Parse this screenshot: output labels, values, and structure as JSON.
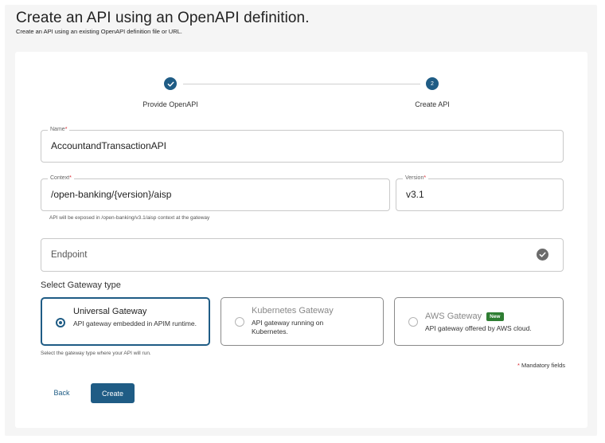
{
  "header": {
    "title": "Create an API using an OpenAPI definition.",
    "subtitle": "Create an API using an existing OpenAPI definition file or URL."
  },
  "stepper": {
    "steps": [
      {
        "label": "Provide OpenAPI",
        "state": "completed",
        "icon": "check-icon"
      },
      {
        "label": "Create API",
        "state": "active",
        "number": "2"
      }
    ]
  },
  "form": {
    "name": {
      "label": "Name",
      "required_mark": "*",
      "value": "AccountandTransactionAPI"
    },
    "context": {
      "label": "Context",
      "required_mark": "*",
      "value": "/open-banking/{version}/aisp",
      "helper": "API will be exposed in /open-banking/v3.1/aisp context at the gateway"
    },
    "version": {
      "label": "Version",
      "required_mark": "*",
      "value": "v3.1"
    },
    "endpoint": {
      "placeholder": "Endpoint",
      "status_icon": "check-circle-icon"
    }
  },
  "gateway": {
    "section_label": "Select Gateway type",
    "options": [
      {
        "title": "Universal Gateway",
        "description": "API gateway embedded in APIM runtime.",
        "selected": true
      },
      {
        "title": "Kubernetes Gateway",
        "description": "API gateway running on Kubernetes.",
        "selected": false,
        "disabled": true
      },
      {
        "title": "AWS Gateway",
        "badge": "New",
        "description": "API gateway offered by AWS cloud.",
        "selected": false
      }
    ],
    "helper": "Select the gateway type where your API will run."
  },
  "footer": {
    "mandatory_mark": "*",
    "mandatory_text": "Mandatory fields",
    "back_label": "Back",
    "create_label": "Create"
  },
  "colors": {
    "primary": "#1f5c85",
    "required": "#d9282f",
    "badge_new": "#2e7d32"
  }
}
